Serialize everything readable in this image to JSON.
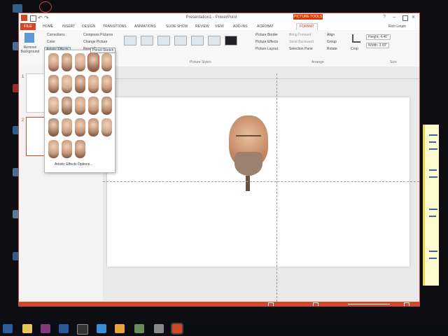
{
  "window": {
    "title": "Presentation1 - PowerPoint",
    "contextual_tab": "PICTURE TOOLS",
    "tabs": [
      "FILE",
      "HOME",
      "INSERT",
      "DESIGN",
      "TRANSITIONS",
      "ANIMATIONS",
      "SLIDE SHOW",
      "REVIEW",
      "VIEW",
      "ADD-INS",
      "ACROBAT",
      "FORMAT"
    ],
    "active_tab": "FORMAT",
    "user": "Rich Leuze"
  },
  "ribbon": {
    "remove_background": "Remove Background",
    "corrections": "Corrections",
    "color": "Color",
    "artistic_effects": "Artistic Effects",
    "compress": "Compress Pictures",
    "change_picture": "Change Picture",
    "reset_picture": "Reset Picture",
    "picture_styles_label": "Picture Styles",
    "picture_border": "Picture Border",
    "picture_effects": "Picture Effects",
    "picture_layout": "Picture Layout",
    "bring_forward": "Bring Forward",
    "send_backward": "Send Backward",
    "selection_pane": "Selection Pane",
    "align": "Align",
    "group": "Group",
    "rotate": "Rotate",
    "arrange_label": "Arrange",
    "crop": "Crop",
    "height": "Height: 4.46\"",
    "width": "Width: 3.00\"",
    "size_label": "Size"
  },
  "slides_panel": {
    "slide_numbers": [
      "1",
      "2"
    ]
  },
  "gallery": {
    "tooltip": "Pencil Sketch",
    "more_options": "Artistic Effects Options..."
  },
  "taskbar": {
    "icons": [
      "explorer-icon",
      "onenote-icon",
      "word-icon",
      "camtasia-icon",
      "ie-icon",
      "chrome-icon",
      "paint-icon",
      "snip-icon",
      "powerpoint-icon"
    ]
  },
  "colors": {
    "accent": "#d24726",
    "statusbar": "#d24726"
  }
}
